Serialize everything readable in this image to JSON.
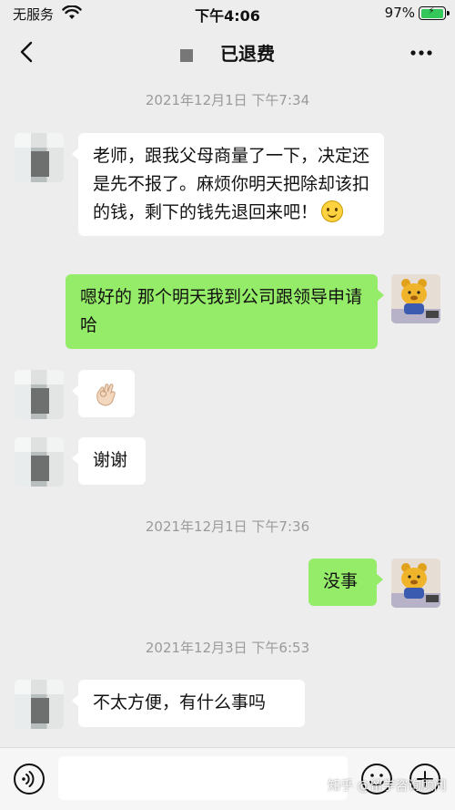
{
  "status_bar": {
    "carrier": "无服务",
    "time": "下午4:06",
    "battery_percent": "97%"
  },
  "nav": {
    "title": "已退费"
  },
  "messages": {
    "ts1": "2021年12月1日 下午7:34",
    "m1": "老师，跟我父母商量了一下，决定还是先不报了。麻烦你明天把除却该扣的钱，剩下的钱先退回来吧！",
    "m2": "嗯好的 那个明天我到公司跟领导申请哈",
    "m4": "谢谢",
    "ts2": "2021年12月1日 下午7:36",
    "m5": "没事",
    "ts3": "2021年12月3日 下午6:53",
    "m6": "不太方便，有什么事吗"
  },
  "icons": {
    "m3_emoji": "ok-hand-icon",
    "m1_emoji": "smiling-face-icon"
  },
  "input": {
    "placeholder": ""
  },
  "watermark": "知乎 @留学咨询顾问",
  "colors": {
    "background": "#ededed",
    "bubble_self": "#95ec69",
    "bubble_other": "#ffffff",
    "timestamp": "#9a9a9a"
  }
}
